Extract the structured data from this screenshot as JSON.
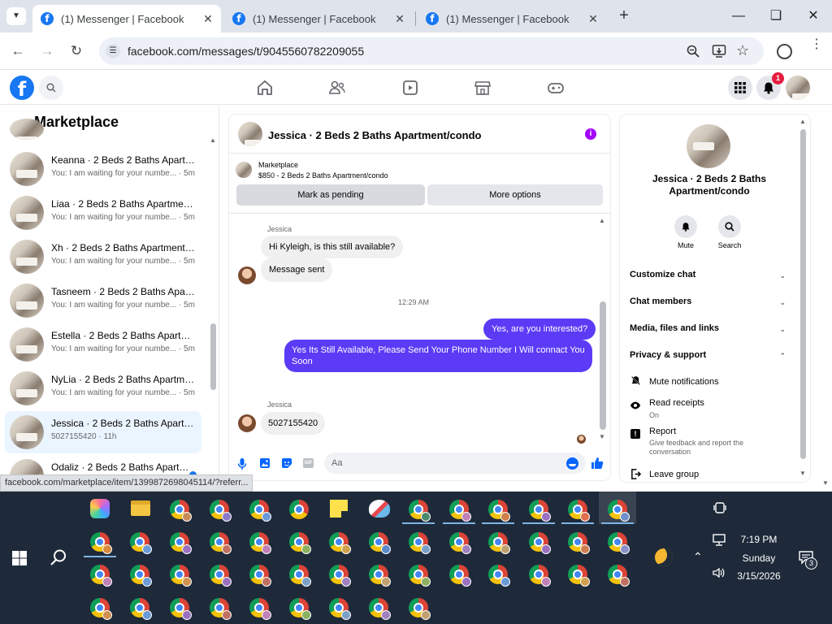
{
  "browser": {
    "tabs": [
      {
        "title": "(1) Messenger | Facebook",
        "active": true
      },
      {
        "title": "(1) Messenger | Facebook",
        "active": false
      },
      {
        "title": "(1) Messenger | Facebook",
        "active": false
      }
    ],
    "url": "facebook.com/messages/t/9045560782209055",
    "status_url": "facebook.com/marketplace/item/1399872698045114/?referr..."
  },
  "fb": {
    "logo": "f",
    "notification_count": "1"
  },
  "left": {
    "title": "Marketplace",
    "conversations": [
      {
        "name": "Keanna · 2 Beds 2 Baths Apartment/condo",
        "preview": "You: I am waiting for your numbe... · 5m",
        "selected": false
      },
      {
        "name": "Liaa · 2 Beds 2 Baths Apartment/condo",
        "preview": "You: I am waiting for your numbe... · 5m",
        "selected": false
      },
      {
        "name": "Xh · 2 Beds 2 Baths Apartment/condo",
        "preview": "You: I am waiting for your numbe... · 5m",
        "selected": false
      },
      {
        "name": "Tasneem · 2 Beds 2 Baths Apartment/condo",
        "preview": "You: I am waiting for your numbe... · 5m",
        "selected": false
      },
      {
        "name": "Estella · 2 Beds 2 Baths Apartment/condo",
        "preview": "You: I am waiting for your numbe... · 5m",
        "selected": false
      },
      {
        "name": "NyLia · 2 Beds 2 Baths Apartment/condo",
        "preview": "You: I am waiting for your numbe... · 5m",
        "selected": false
      },
      {
        "name": "Jessica · 2 Beds 2 Baths Apartment/condo",
        "preview": "5027155420 · 11h",
        "selected": true
      },
      {
        "name": "Odaliz · 2 Beds 2 Baths Apartment/condo",
        "preview": "",
        "selected": false
      }
    ]
  },
  "chat": {
    "title": "Jessica · 2 Beds 2 Baths Apartment/condo",
    "listing_label": "Marketplace",
    "listing_detail": "$850 - 2 Beds 2 Baths Apartment/condo",
    "mark_pending": "Mark as pending",
    "more_options": "More options",
    "sender1": "Jessica",
    "msg1": "Hi Kyleigh, is this still available?",
    "msg2": "Message sent",
    "time": "12:29 AM",
    "msg3": "Yes, are you interested?",
    "msg4": "Yes Its Still Available, Please Send Your Phone Number I Will connact You Soon",
    "sender2": "Jessica",
    "msg5": "5027155420",
    "placeholder": "Aa",
    "gif": "GIF"
  },
  "right": {
    "name": "Jessica · 2 Beds 2 Baths Apartment/condo",
    "mute": "Mute",
    "search": "Search",
    "customize": "Customize chat",
    "members": "Chat members",
    "media": "Media, files and links",
    "privacy": "Privacy & support",
    "mute_notifications": "Mute notifications",
    "read_receipts": "Read receipts",
    "read_receipts_state": "On",
    "report": "Report",
    "report_desc": "Give feedback and report the conversation",
    "leave": "Leave group"
  },
  "taskbar": {
    "time": "7:19 PM",
    "day": "Sunday",
    "date": "3/15/2026",
    "notif_count": "3"
  }
}
